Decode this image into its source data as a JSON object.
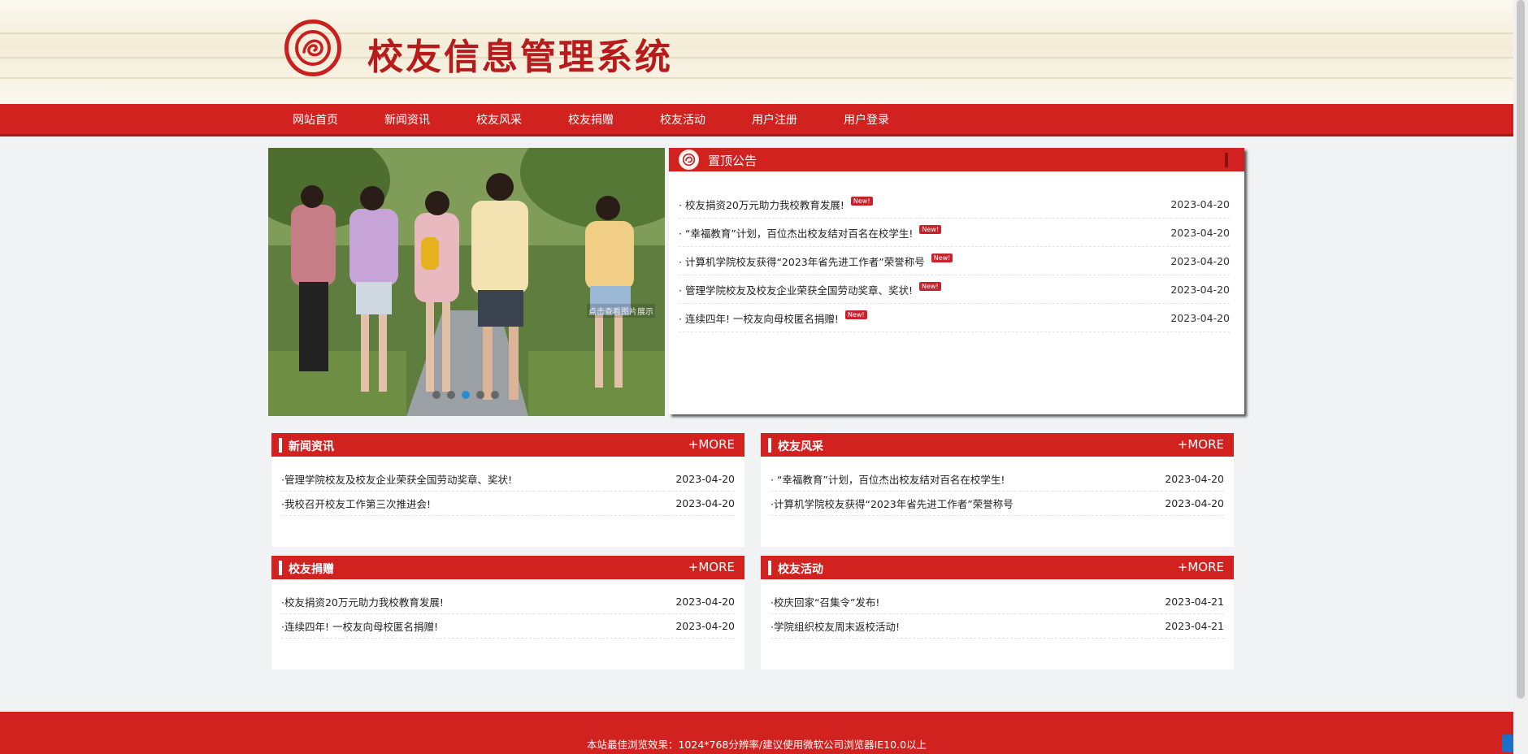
{
  "site": {
    "title": "校友信息管理系统"
  },
  "nav": {
    "items": [
      "网站首页",
      "新闻资讯",
      "校友风采",
      "校友捐赠",
      "校友活动",
      "用户注册",
      "用户登录"
    ]
  },
  "slider": {
    "caption": "点击查看图片展示",
    "dot_count": 5,
    "active_index": 2
  },
  "notice": {
    "title": "置顶公告",
    "badge": "New!",
    "items": [
      {
        "text": "· 校友捐资20万元助力我校教育发展!",
        "date": "2023-04-20"
      },
      {
        "text": "· “幸福教育”计划，百位杰出校友结对百名在校学生!",
        "date": "2023-04-20"
      },
      {
        "text": "· 计算机学院校友获得“2023年省先进工作者”荣誉称号",
        "date": "2023-04-20"
      },
      {
        "text": "· 管理学院校友及校友企业荣获全国劳动奖章、奖状!",
        "date": "2023-04-20"
      },
      {
        "text": "· 连续四年! 一校友向母校匿名捐赠!",
        "date": "2023-04-20"
      }
    ]
  },
  "panels": {
    "more_label": "+MORE",
    "news": {
      "title": "新闻资讯",
      "items": [
        {
          "text": "·管理学院校友及校友企业荣获全国劳动奖章、奖状!",
          "date": "2023-04-20"
        },
        {
          "text": "·我校召开校友工作第三次推进会!",
          "date": "2023-04-20"
        }
      ]
    },
    "style": {
      "title": "校友风采",
      "items": [
        {
          "text": "· “幸福教育”计划，百位杰出校友结对百名在校学生!",
          "date": "2023-04-20"
        },
        {
          "text": "·计算机学院校友获得“2023年省先进工作者”荣誉称号",
          "date": "2023-04-20"
        }
      ]
    },
    "donation": {
      "title": "校友捐赠",
      "items": [
        {
          "text": "·校友捐资20万元助力我校教育发展!",
          "date": "2023-04-20"
        },
        {
          "text": "·连续四年! 一校友向母校匿名捐赠!",
          "date": "2023-04-20"
        }
      ]
    },
    "activity": {
      "title": "校友活动",
      "items": [
        {
          "text": "·校庆回家“召集令”发布!",
          "date": "2023-04-21"
        },
        {
          "text": "·学院组织校友周末返校活动!",
          "date": "2023-04-21"
        }
      ]
    }
  },
  "footer": {
    "text": "本站最佳浏览效果：1024*768分辨率/建议使用微软公司浏览器IE10.0以上"
  },
  "colors": {
    "brand_red": "#d2221f",
    "dark_red": "#a41816",
    "badge_red": "#c8232a",
    "active_dot": "#2a8ad4"
  }
}
